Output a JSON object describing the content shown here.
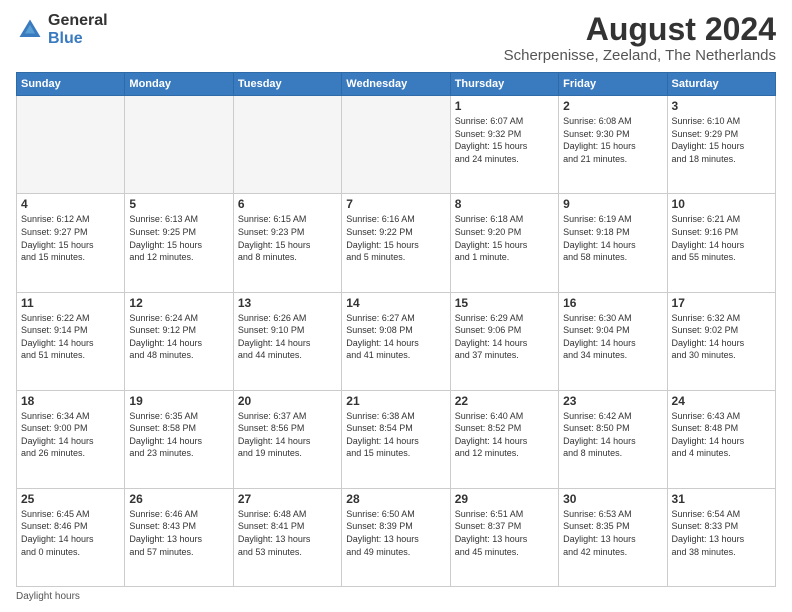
{
  "header": {
    "logo": {
      "text_general": "General",
      "text_blue": "Blue"
    },
    "month_year": "August 2024",
    "location": "Scherpenisse, Zeeland, The Netherlands"
  },
  "calendar": {
    "days_of_week": [
      "Sunday",
      "Monday",
      "Tuesday",
      "Wednesday",
      "Thursday",
      "Friday",
      "Saturday"
    ],
    "weeks": [
      [
        {
          "day": "",
          "info": ""
        },
        {
          "day": "",
          "info": ""
        },
        {
          "day": "",
          "info": ""
        },
        {
          "day": "",
          "info": ""
        },
        {
          "day": "1",
          "info": "Sunrise: 6:07 AM\nSunset: 9:32 PM\nDaylight: 15 hours\nand 24 minutes."
        },
        {
          "day": "2",
          "info": "Sunrise: 6:08 AM\nSunset: 9:30 PM\nDaylight: 15 hours\nand 21 minutes."
        },
        {
          "day": "3",
          "info": "Sunrise: 6:10 AM\nSunset: 9:29 PM\nDaylight: 15 hours\nand 18 minutes."
        }
      ],
      [
        {
          "day": "4",
          "info": "Sunrise: 6:12 AM\nSunset: 9:27 PM\nDaylight: 15 hours\nand 15 minutes."
        },
        {
          "day": "5",
          "info": "Sunrise: 6:13 AM\nSunset: 9:25 PM\nDaylight: 15 hours\nand 12 minutes."
        },
        {
          "day": "6",
          "info": "Sunrise: 6:15 AM\nSunset: 9:23 PM\nDaylight: 15 hours\nand 8 minutes."
        },
        {
          "day": "7",
          "info": "Sunrise: 6:16 AM\nSunset: 9:22 PM\nDaylight: 15 hours\nand 5 minutes."
        },
        {
          "day": "8",
          "info": "Sunrise: 6:18 AM\nSunset: 9:20 PM\nDaylight: 15 hours\nand 1 minute."
        },
        {
          "day": "9",
          "info": "Sunrise: 6:19 AM\nSunset: 9:18 PM\nDaylight: 14 hours\nand 58 minutes."
        },
        {
          "day": "10",
          "info": "Sunrise: 6:21 AM\nSunset: 9:16 PM\nDaylight: 14 hours\nand 55 minutes."
        }
      ],
      [
        {
          "day": "11",
          "info": "Sunrise: 6:22 AM\nSunset: 9:14 PM\nDaylight: 14 hours\nand 51 minutes."
        },
        {
          "day": "12",
          "info": "Sunrise: 6:24 AM\nSunset: 9:12 PM\nDaylight: 14 hours\nand 48 minutes."
        },
        {
          "day": "13",
          "info": "Sunrise: 6:26 AM\nSunset: 9:10 PM\nDaylight: 14 hours\nand 44 minutes."
        },
        {
          "day": "14",
          "info": "Sunrise: 6:27 AM\nSunset: 9:08 PM\nDaylight: 14 hours\nand 41 minutes."
        },
        {
          "day": "15",
          "info": "Sunrise: 6:29 AM\nSunset: 9:06 PM\nDaylight: 14 hours\nand 37 minutes."
        },
        {
          "day": "16",
          "info": "Sunrise: 6:30 AM\nSunset: 9:04 PM\nDaylight: 14 hours\nand 34 minutes."
        },
        {
          "day": "17",
          "info": "Sunrise: 6:32 AM\nSunset: 9:02 PM\nDaylight: 14 hours\nand 30 minutes."
        }
      ],
      [
        {
          "day": "18",
          "info": "Sunrise: 6:34 AM\nSunset: 9:00 PM\nDaylight: 14 hours\nand 26 minutes."
        },
        {
          "day": "19",
          "info": "Sunrise: 6:35 AM\nSunset: 8:58 PM\nDaylight: 14 hours\nand 23 minutes."
        },
        {
          "day": "20",
          "info": "Sunrise: 6:37 AM\nSunset: 8:56 PM\nDaylight: 14 hours\nand 19 minutes."
        },
        {
          "day": "21",
          "info": "Sunrise: 6:38 AM\nSunset: 8:54 PM\nDaylight: 14 hours\nand 15 minutes."
        },
        {
          "day": "22",
          "info": "Sunrise: 6:40 AM\nSunset: 8:52 PM\nDaylight: 14 hours\nand 12 minutes."
        },
        {
          "day": "23",
          "info": "Sunrise: 6:42 AM\nSunset: 8:50 PM\nDaylight: 14 hours\nand 8 minutes."
        },
        {
          "day": "24",
          "info": "Sunrise: 6:43 AM\nSunset: 8:48 PM\nDaylight: 14 hours\nand 4 minutes."
        }
      ],
      [
        {
          "day": "25",
          "info": "Sunrise: 6:45 AM\nSunset: 8:46 PM\nDaylight: 14 hours\nand 0 minutes."
        },
        {
          "day": "26",
          "info": "Sunrise: 6:46 AM\nSunset: 8:43 PM\nDaylight: 13 hours\nand 57 minutes."
        },
        {
          "day": "27",
          "info": "Sunrise: 6:48 AM\nSunset: 8:41 PM\nDaylight: 13 hours\nand 53 minutes."
        },
        {
          "day": "28",
          "info": "Sunrise: 6:50 AM\nSunset: 8:39 PM\nDaylight: 13 hours\nand 49 minutes."
        },
        {
          "day": "29",
          "info": "Sunrise: 6:51 AM\nSunset: 8:37 PM\nDaylight: 13 hours\nand 45 minutes."
        },
        {
          "day": "30",
          "info": "Sunrise: 6:53 AM\nSunset: 8:35 PM\nDaylight: 13 hours\nand 42 minutes."
        },
        {
          "day": "31",
          "info": "Sunrise: 6:54 AM\nSunset: 8:33 PM\nDaylight: 13 hours\nand 38 minutes."
        }
      ]
    ]
  },
  "footer": {
    "text": "Daylight hours"
  }
}
